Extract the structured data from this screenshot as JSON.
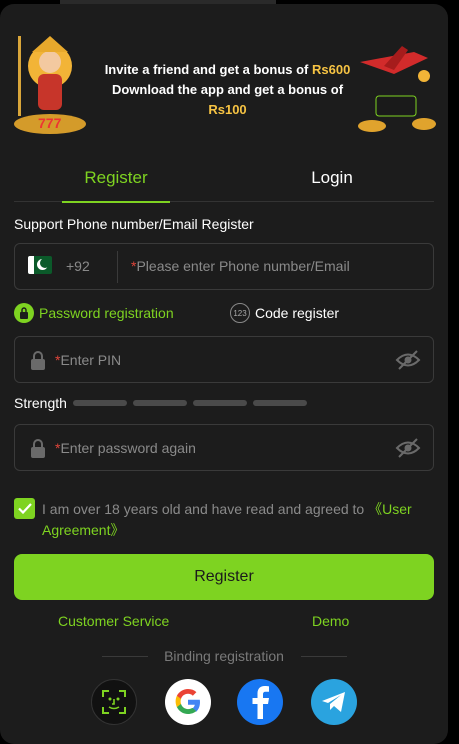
{
  "banner": {
    "line1_prefix": "Invite a friend and get a bonus of ",
    "line1_amount": "Rs600",
    "line2_prefix": "Download the app and get a bonus of ",
    "line2_amount": "Rs100"
  },
  "tabs": [
    {
      "label": "Register",
      "active": true
    },
    {
      "label": "Login",
      "active": false
    }
  ],
  "form": {
    "section_label": "Support Phone number/Email Register",
    "country_code": "+92",
    "phone_placeholder": "Please enter Phone number/Email",
    "method_password": "Password registration",
    "method_code_badge": "123",
    "method_code": "Code register",
    "pin_placeholder": "Enter PIN",
    "strength_label": "Strength",
    "confirm_placeholder": "Enter password again",
    "required_mark": "*"
  },
  "agreement": {
    "text": "I am over 18 years old and have read and agreed to ",
    "link": "《User Agreement》",
    "checked": true
  },
  "register_button": "Register",
  "links": {
    "customer_service": "Customer Service",
    "demo": "Demo"
  },
  "binding_label": "Binding registration",
  "social_icons": [
    "face-id-icon",
    "google-icon",
    "facebook-icon",
    "telegram-icon"
  ],
  "colors": {
    "accent": "#7ed321",
    "background": "#1c1c1c",
    "amount": "#f6c343",
    "required": "#e0453a"
  }
}
